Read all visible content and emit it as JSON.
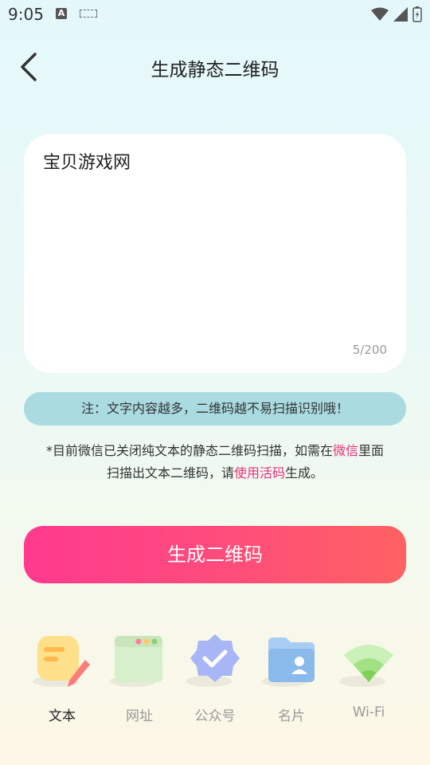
{
  "status_bar": {
    "time": "9:05",
    "a_label": "A"
  },
  "header": {
    "title": "生成静态二维码"
  },
  "editor": {
    "text": "宝贝游戏网",
    "count": "5/200"
  },
  "notice": "注：文字内容越多，二维码越不易扫描识别哦！",
  "hint": {
    "part1": "*目前微信已关闭纯文本的静态二维码扫描，如需在",
    "link1": "微信",
    "part2": "里面",
    "part3": "扫描出文本二维码，请",
    "link2": "使用活码",
    "part4": "生成。"
  },
  "generate_button": "生成二维码",
  "tabs": [
    {
      "label": "文本",
      "icon": "note-pencil-icon",
      "active": true
    },
    {
      "label": "网址",
      "icon": "browser-window-icon",
      "active": false
    },
    {
      "label": "公众号",
      "icon": "verified-badge-icon",
      "active": false
    },
    {
      "label": "名片",
      "icon": "folder-contact-icon",
      "active": false
    },
    {
      "label": "Wi-Fi",
      "icon": "wifi-icon",
      "active": false
    }
  ],
  "colors": {
    "accent": "#ff4d7a",
    "link": "#e9307a",
    "notice_bg": "#a9dbe1"
  }
}
